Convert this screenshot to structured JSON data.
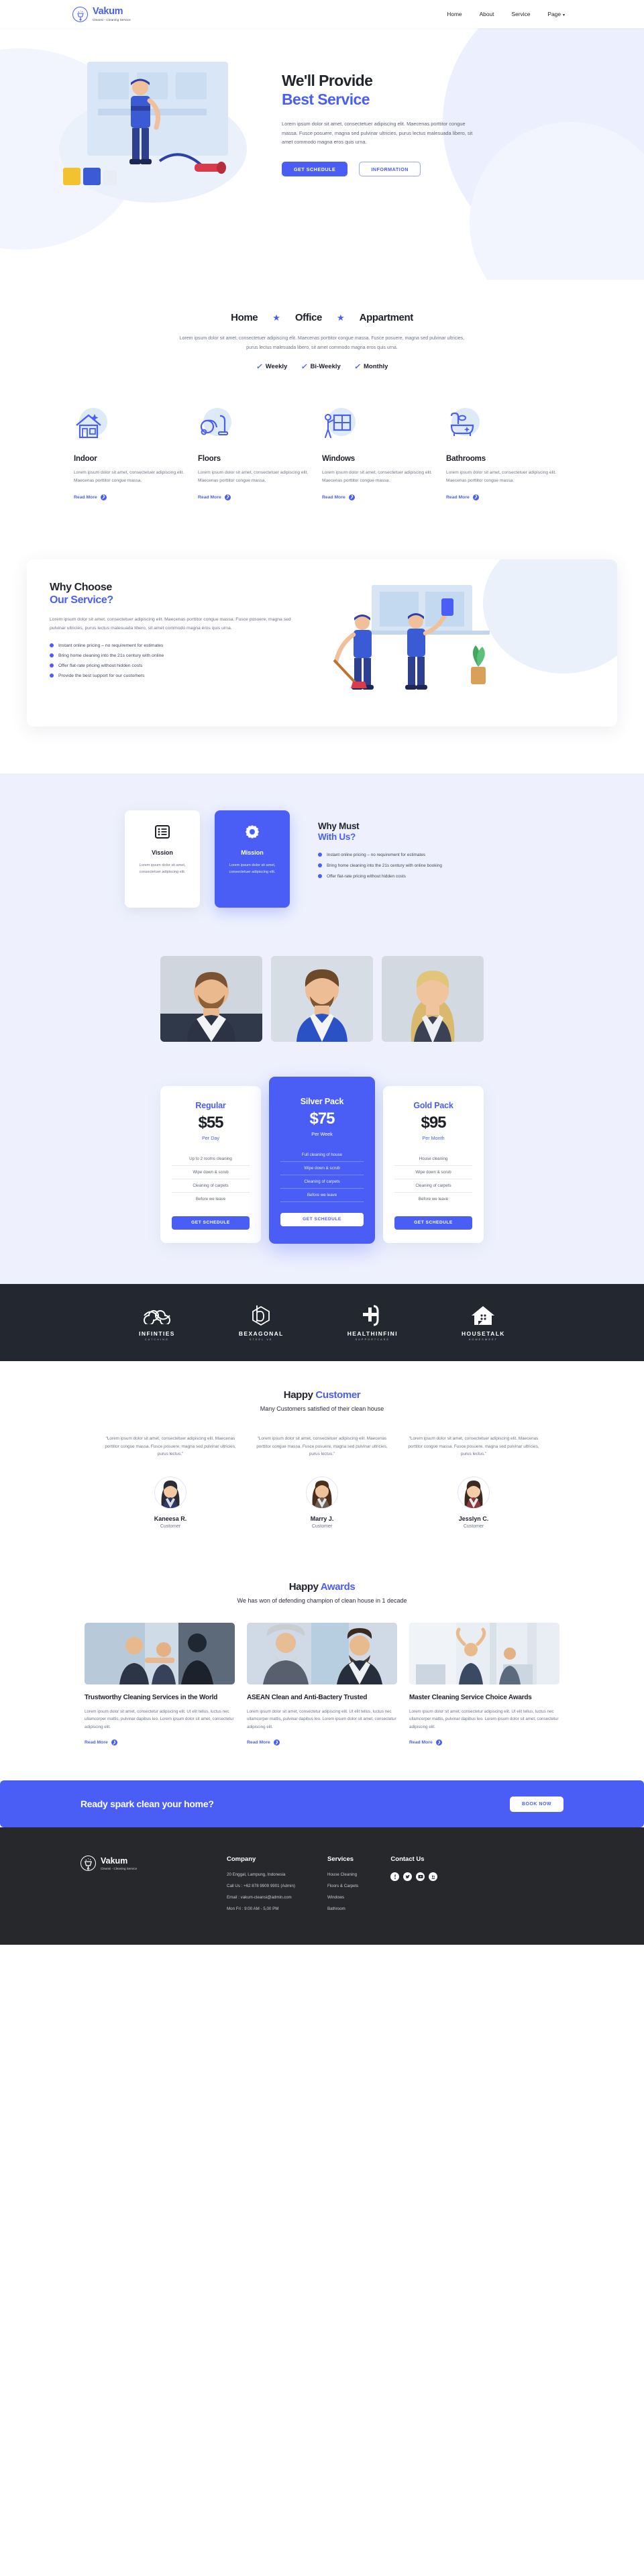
{
  "brand": {
    "name": "Vakum",
    "tagline": "Cleansi - Cleaning Service",
    "logo_icon": "vacuum-sparkle-icon",
    "accent_color": "#4a5ef5"
  },
  "nav": {
    "items": [
      {
        "label": "Home",
        "name": "nav-home"
      },
      {
        "label": "About",
        "name": "nav-about"
      },
      {
        "label": "Service",
        "name": "nav-service"
      },
      {
        "label": "Page",
        "name": "nav-page",
        "caret": "▾"
      }
    ]
  },
  "hero": {
    "title_line1": "We'll Provide",
    "title_line2": "Best Service",
    "paragraph": "Lorem ipsum dolor sit amet, consectetuer adipiscing elit. Maecenas porttitor congue massa. Fusce posuere, magna sed pulvinar ultricies, purus lectus malesuada libero, sit amet commodo magna eros quis urna.",
    "primary_button": "GET SCHEDULE",
    "secondary_button": "INFORMATION"
  },
  "categories": {
    "items": [
      "Home",
      "Office",
      "Appartment"
    ],
    "separator_icon": "star-icon",
    "paragraph": "Lorem ipsum dolor sit amet, consectetuer adipiscing elit. Maecenas porttitor congue massa. Fusce posuere, magna sed pulvinar ultricies, purus lectus malesuada libero, sit amet commodo magna eros quis urna.",
    "frequencies": [
      "Weekly",
      "Bi-Weekly",
      "Monthly"
    ],
    "check_icon": "check-icon"
  },
  "services": {
    "read_more": "Read More",
    "items": [
      {
        "title": "Indoor",
        "icon": "house-sparkle-icon",
        "text": "Lorem ipsum dolor sit amet, consectetuer adipiscing elit. Maecenas porttitor congue massa."
      },
      {
        "title": "Floors",
        "icon": "vacuum-cleaner-icon",
        "text": "Lorem ipsum dolor sit amet, consectetuer adipiscing elit. Maecenas porttitor congue massa."
      },
      {
        "title": "Windows",
        "icon": "window-cleaner-icon",
        "text": "Lorem ipsum dolor sit amet, consectetuer adipiscing elit. Maecenas porttitor congue massa."
      },
      {
        "title": "Bathrooms",
        "icon": "bathtub-icon",
        "text": "Lorem ipsum dolor sit amet, consectetuer adipiscing elit. Maecenas porttitor congue massa."
      }
    ]
  },
  "why_choose": {
    "title_line1": "Why Choose",
    "title_line2": "Our Service?",
    "paragraph": "Lorem ipsum dolor sit amet, consectetuer adipiscing elit. Maecenas porttitor congue massa. Fusce posuere, magna sed pulvinar ultricies, purus lectus malesuada libero, sit amet commodo magna eros quis urna.",
    "bullets": [
      "Instant online pricing – no requirement for estimates",
      "Bring home cleaning into the 21s century with online",
      "Offer flat-rate pricing without hidden costs",
      "Provide the best support for our customers"
    ]
  },
  "vision_mission": {
    "cards": [
      {
        "title": "Vission",
        "icon": "list-icon",
        "text": "Lorem ipsum dolor sit amet, consectetuer adipiscing elit."
      },
      {
        "title": "Mission",
        "icon": "gear-icon",
        "text": "Lorem ipsum dolor sit amet, consectetuer adipiscing elit."
      }
    ],
    "title_line1": "Why Must",
    "title_line2": "With Us?",
    "bullets": [
      "Instant online pricing – no requirement for estimates",
      "Bring home cleaning into the 21s century with online booking",
      "Offer flat-rate pricing without hidden costs"
    ]
  },
  "team": {
    "photos": [
      "team-photo-man-beard",
      "team-photo-man-blue-jacket",
      "team-photo-woman-blonde"
    ]
  },
  "pricing": {
    "plans": [
      {
        "name": "Regular",
        "price": "$55",
        "per": "Per Day",
        "featured": false,
        "features": [
          "Up to 2 rooms cleaning",
          "Wipe down & scrub",
          "Cleaning of carpets",
          "Before we leave"
        ],
        "button": "GET SCHEDULE"
      },
      {
        "name": "Silver Pack",
        "price": "$75",
        "per": "Per Week",
        "featured": true,
        "features": [
          "Full cleaning of house",
          "Wipe down & scrub",
          "Cleaning of carpets",
          "Before we leave"
        ],
        "button": "GET SCHEDULE"
      },
      {
        "name": "Gold Pack",
        "price": "$95",
        "per": "Per Month",
        "featured": false,
        "features": [
          "House cleaning",
          "Wipe down & scrub",
          "Cleaning of carpets",
          "Before we leave"
        ],
        "button": "GET SCHEDULE"
      }
    ]
  },
  "client_logos": [
    {
      "name": "INFINTIES",
      "sub": "CATCHING",
      "icon": "infinity-knot-icon"
    },
    {
      "name": "BEXAGONAL",
      "sub": "STEEL VE",
      "icon": "hexagon-b-icon"
    },
    {
      "name": "HEALTHINFINI",
      "sub": "SUPPORTCARE",
      "icon": "medical-cross-icon"
    },
    {
      "name": "HOUSETALK",
      "sub": "HOMESWEET",
      "icon": "house-chat-icon"
    }
  ],
  "testimonials": {
    "title_plain": "Happy ",
    "title_accent": "Customer",
    "subtitle": "Many Customers satisfied of their clean house",
    "items": [
      {
        "quote": "“Lorem ipsum dolor sit amet, consectetuer adipiscing elit. Maecenas porttitor congue massa. Fusce posuere, magna sed pulvinar ultricies, purus lectus.”",
        "name": "Kaneesa R.",
        "role": "Customer",
        "avatar": "avatar-woman-dark-hair"
      },
      {
        "quote": "“Lorem ipsum dolor sit amet, consectetuer adipiscing elit. Maecenas porttitor congue massa. Fusce posuere, magna sed pulvinar ultricies, purus lectus.”",
        "name": "Marry J.",
        "role": "Customer",
        "avatar": "avatar-woman-brown-hair"
      },
      {
        "quote": "“Lorem ipsum dolor sit amet, consectetuer adipiscing elit. Maecenas porttitor congue massa. Fusce posuere, magna sed pulvinar ultricies, purus lectus.”",
        "name": "Jesslyn C.",
        "role": "Customer",
        "avatar": "avatar-woman-smiling"
      }
    ]
  },
  "awards": {
    "title_plain": "Happy ",
    "title_accent": "Awards",
    "subtitle": "We has won of defending champion of clean house in 1 decade",
    "read_more": "Read More",
    "items": [
      {
        "title": "Trustworthy Cleaning Services in the World",
        "text": "Lorem ipsum dolor sit amet, consectetur adipiscing elit. Ut elit tellus, luctus nec ullamcorper mattis, pulvinar dapibus leo. Lorem ipsum dolor sit amet, consectetur adipiscing elit.",
        "image": "award-photo-handshake-meeting"
      },
      {
        "title": "ASEAN Clean and Anti-Bactery Trusted",
        "text": "Lorem ipsum dolor sit amet, consectetur adipiscing elit. Ut elit tellus, luctus nec ullamcorper mattis, pulvinar dapibus leo. Lorem ipsum dolor sit amet, consectetur adipiscing elit.",
        "image": "award-photo-two-men-talking"
      },
      {
        "title": "Master Cleaning Service Choice Awards",
        "text": "Lorem ipsum dolor sit amet, consectetur adipiscing elit. Ut elit tellus, luctus nec ullamcorper mattis, pulvinar dapibus leo. Lorem ipsum dolor sit amet, consectetur adipiscing elit.",
        "image": "award-photo-office-celebration"
      }
    ]
  },
  "cta": {
    "headline": "Ready spark clean your home?",
    "button": "BOOK NOW"
  },
  "footer": {
    "company": {
      "heading": "Company",
      "items": [
        "20 Enggal, Lampung, Indonesia",
        "Call Us : +62 878 9909 9901 (Admin)",
        "Email : vakum-cleansi@admin.com",
        "Mon Fri : 9:00 AM - 5,00 PM"
      ]
    },
    "services": {
      "heading": "Services",
      "items": [
        "House Cleaning",
        "Floors & Carpets",
        "Windows",
        "Bathroom"
      ]
    },
    "contact": {
      "heading": "Contact Us",
      "socials": [
        {
          "name": "facebook-icon",
          "glyph": "f"
        },
        {
          "name": "twitter-icon",
          "glyph": "ᵗ"
        },
        {
          "name": "youtube-icon",
          "glyph": "▶"
        },
        {
          "name": "linkedin-icon",
          "glyph": "in"
        }
      ]
    }
  }
}
